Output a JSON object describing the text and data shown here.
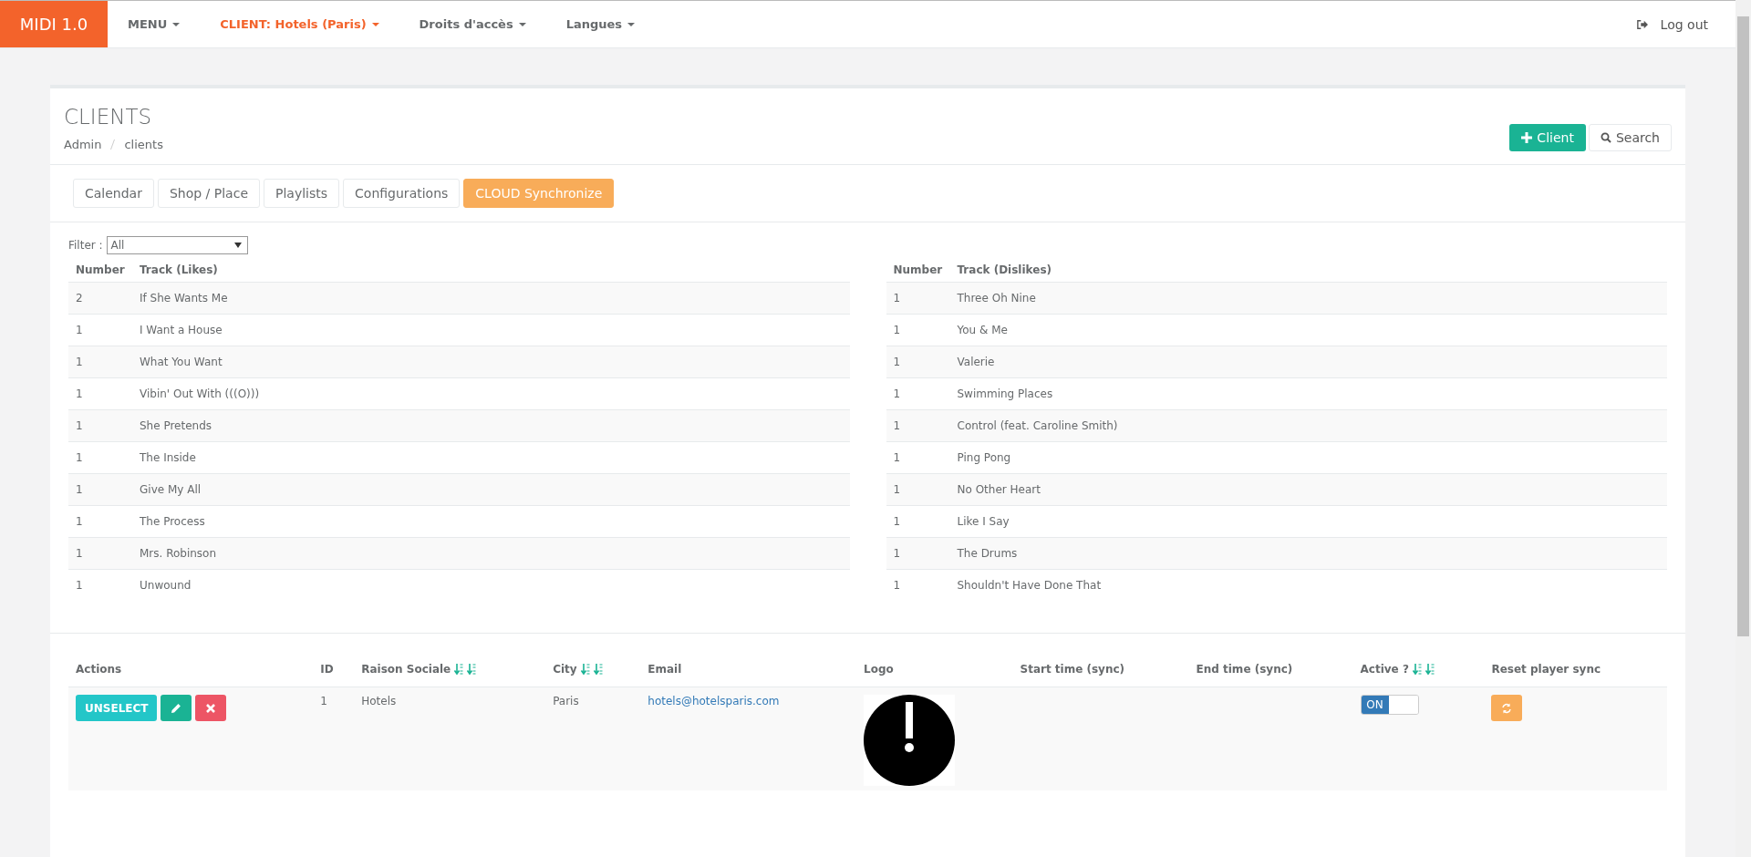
{
  "navbar": {
    "brand": "MIDI 1.0",
    "menus": [
      {
        "label": "MENU",
        "highlighted": false
      },
      {
        "label": "CLIENT: Hotels (Paris)",
        "highlighted": true
      },
      {
        "label": "Droits d'accès",
        "highlighted": false
      },
      {
        "label": "Langues",
        "highlighted": false
      }
    ],
    "logout": "Log out"
  },
  "page": {
    "title": "CLIENTS",
    "breadcrumb": [
      "Admin",
      "clients"
    ],
    "add_button": "Client",
    "search_button": "Search"
  },
  "tabs": [
    {
      "label": "Calendar",
      "selected": false
    },
    {
      "label": "Shop / Place",
      "selected": false
    },
    {
      "label": "Playlists",
      "selected": false
    },
    {
      "label": "Configurations",
      "selected": false
    },
    {
      "label": "CLOUD Synchronize",
      "selected": true
    }
  ],
  "filter": {
    "label": "Filter :",
    "value": "All"
  },
  "likes": {
    "columns": [
      "Number",
      "Track (Likes)"
    ],
    "rows": [
      [
        "2",
        "If She Wants Me"
      ],
      [
        "1",
        "I Want a House"
      ],
      [
        "1",
        "What You Want"
      ],
      [
        "1",
        "Vibin' Out With (((O)))"
      ],
      [
        "1",
        "She Pretends"
      ],
      [
        "1",
        "The Inside"
      ],
      [
        "1",
        "Give My All"
      ],
      [
        "1",
        "The Process"
      ],
      [
        "1",
        "Mrs. Robinson"
      ],
      [
        "1",
        "Unwound"
      ]
    ]
  },
  "dislikes": {
    "columns": [
      "Number",
      "Track (Dislikes)"
    ],
    "rows": [
      [
        "1",
        "Three Oh Nine"
      ],
      [
        "1",
        "You & Me"
      ],
      [
        "1",
        "Valerie"
      ],
      [
        "1",
        "Swimming Places"
      ],
      [
        "1",
        "Control (feat. Caroline Smith)"
      ],
      [
        "1",
        "Ping Pong"
      ],
      [
        "1",
        "No Other Heart"
      ],
      [
        "1",
        "Like I Say"
      ],
      [
        "1",
        "The Drums"
      ],
      [
        "1",
        "Shouldn't Have Done That"
      ]
    ]
  },
  "clients": {
    "columns": [
      {
        "label": "Actions",
        "sortable": false
      },
      {
        "label": "ID",
        "sortable": false
      },
      {
        "label": "Raison Sociale",
        "sortable": true
      },
      {
        "label": "City",
        "sortable": true
      },
      {
        "label": "Email",
        "sortable": false
      },
      {
        "label": "Logo",
        "sortable": false
      },
      {
        "label": "Start time (sync)",
        "sortable": false
      },
      {
        "label": "End time (sync)",
        "sortable": false
      },
      {
        "label": "Active ?",
        "sortable": true
      },
      {
        "label": "Reset player sync",
        "sortable": false
      }
    ],
    "rows": [
      {
        "unselect": "UNSELECT",
        "id": "1",
        "name": "Hotels",
        "city": "Paris",
        "email": "hotels@hotelsparis.com",
        "active_label": "ON",
        "active": true
      }
    ]
  }
}
